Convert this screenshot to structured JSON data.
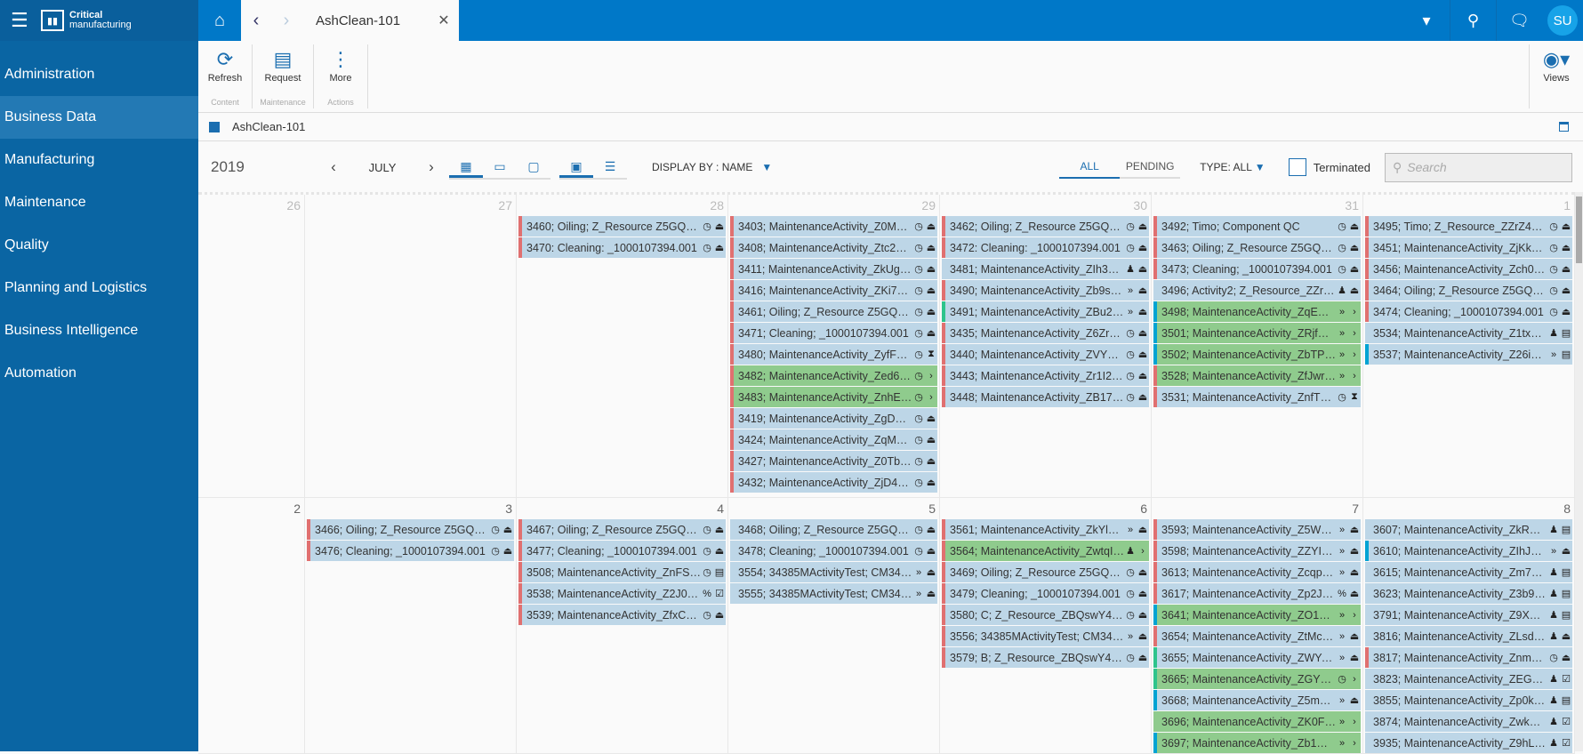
{
  "app": {
    "brand_top": "Critical",
    "brand_bottom": "manufacturing",
    "user_initials": "SU"
  },
  "tab": {
    "title": "AshClean-101"
  },
  "sidebar": {
    "items": [
      {
        "label": "Administration"
      },
      {
        "label": "Business Data",
        "active": true
      },
      {
        "label": "Manufacturing"
      },
      {
        "label": "Maintenance"
      },
      {
        "label": "Quality"
      },
      {
        "label": "Planning and Logistics"
      },
      {
        "label": "Business Intelligence"
      },
      {
        "label": "Automation"
      }
    ]
  },
  "toolbar": {
    "refresh": "Refresh",
    "request": "Request",
    "more": "More",
    "views": "Views",
    "group_content": "Content",
    "group_maintenance": "Maintenance",
    "group_actions": "Actions"
  },
  "breadcrumb": {
    "title": "AshClean-101"
  },
  "controls": {
    "year": "2019",
    "month": "JULY",
    "display_by": "DISPLAY BY : NAME",
    "filter_all": "ALL",
    "filter_pending": "PENDING",
    "type": "TYPE: ALL",
    "terminated": "Terminated",
    "search_placeholder": "Search"
  },
  "colors": {
    "accent": "#0078c8",
    "red": "#e07070",
    "teal": "#2ec48c",
    "cyan": "#00a3d3",
    "event_bg": "#bdd6e7",
    "event_green": "#8fcb8d"
  },
  "weeks": [
    {
      "days": [
        {
          "day": "26",
          "events": []
        },
        {
          "day": "27",
          "events": []
        },
        {
          "day": "28",
          "events": [
            {
              "text": "3460; Oiling; Z_Resource Z5GQkkWOn...",
              "bar": "red",
              "icons": [
                "clock",
                "eject"
              ]
            },
            {
              "text": "3470: Cleaning: _1000107394.001",
              "bar": "red",
              "icons": [
                "clock",
                "eject"
              ]
            }
          ]
        },
        {
          "day": "29",
          "events": [
            {
              "text": "3403; MaintenanceActivity_Z0M9FXqlt...",
              "bar": "red",
              "icons": [
                "clock",
                "eject"
              ]
            },
            {
              "text": "3408; MaintenanceActivity_Ztc2uKFak...",
              "bar": "red",
              "icons": [
                "clock",
                "eject"
              ]
            },
            {
              "text": "3411; MaintenanceActivity_ZkUgwpaYi...",
              "bar": "red",
              "icons": [
                "clock",
                "eject"
              ]
            },
            {
              "text": "3416; MaintenanceActivity_ZKi7cmgVP...",
              "bar": "red",
              "icons": [
                "clock",
                "eject"
              ]
            },
            {
              "text": "3461; Oiling; Z_Resource Z5GQkkWOn...",
              "bar": "red",
              "icons": [
                "clock",
                "eject"
              ]
            },
            {
              "text": "3471; Cleaning; _1000107394.001",
              "bar": "red",
              "icons": [
                "clock",
                "eject"
              ]
            },
            {
              "text": "3480; MaintenanceActivity_ZyfF3Xcba...",
              "bar": "red",
              "icons": [
                "clock",
                "hourglass"
              ]
            },
            {
              "text": "3482; MaintenanceActivity_Zed6lmUCl...",
              "bar": "red",
              "green": true,
              "icons": [
                "clock",
                "chevron"
              ]
            },
            {
              "text": "3483; MaintenanceActivity_ZnhEJ7mb...",
              "bar": "red",
              "green": true,
              "icons": [
                "clock",
                "chevron"
              ]
            },
            {
              "text": "3419; MaintenanceActivity_ZgDQ1cRB...",
              "bar": "red",
              "icons": [
                "clock",
                "eject"
              ]
            },
            {
              "text": "3424; MaintenanceActivity_ZqMYjzA66...",
              "bar": "red",
              "icons": [
                "clock",
                "eject"
              ]
            },
            {
              "text": "3427; MaintenanceActivity_Z0TbYPqEy...",
              "bar": "red",
              "icons": [
                "clock",
                "eject"
              ]
            },
            {
              "text": "3432; MaintenanceActivity_ZjD4A4Cxa...",
              "bar": "red",
              "icons": [
                "clock",
                "eject"
              ]
            }
          ]
        },
        {
          "day": "30",
          "events": [
            {
              "text": "3462; Oiling; Z_Resource Z5GQkkWOn...",
              "bar": "red",
              "icons": [
                "clock",
                "eject"
              ]
            },
            {
              "text": "3472: Cleaning: _1000107394.001",
              "bar": "red",
              "icons": [
                "clock",
                "eject"
              ]
            },
            {
              "text": "3481; MaintenanceActivity_ZIh3w9yCC...",
              "bar": "none",
              "icons": [
                "person",
                "eject"
              ]
            },
            {
              "text": "3490; MaintenanceActivity_Zb9sHaPX...",
              "bar": "red",
              "icons": [
                "triple",
                "eject"
              ]
            },
            {
              "text": "3491; MaintenanceActivity_ZBu26yocu...",
              "bar": "teal",
              "icons": [
                "triple",
                "eject"
              ]
            },
            {
              "text": "3435; MaintenanceActivity_Z6ZroGwU...",
              "bar": "red",
              "icons": [
                "clock",
                "eject"
              ]
            },
            {
              "text": "3440; MaintenanceActivity_ZVYYSP0vy...",
              "bar": "red",
              "icons": [
                "clock",
                "eject"
              ]
            },
            {
              "text": "3443; MaintenanceActivity_Zr1I2OIRd...",
              "bar": "red",
              "icons": [
                "clock",
                "eject"
              ]
            },
            {
              "text": "3448; MaintenanceActivity_ZB17EtSXK...",
              "bar": "red",
              "icons": [
                "clock",
                "eject"
              ]
            }
          ]
        },
        {
          "day": "31",
          "events": [
            {
              "text": "3492; Timo; Component QC",
              "bar": "red",
              "icons": [
                "clock",
                "eject"
              ]
            },
            {
              "text": "3463; Oiling; Z_Resource Z5GQkkWOn...",
              "bar": "red",
              "icons": [
                "clock",
                "eject"
              ]
            },
            {
              "text": "3473; Cleaning; _1000107394.001",
              "bar": "red",
              "icons": [
                "clock",
                "eject"
              ]
            },
            {
              "text": "3496; Activity2; Z_Resource_ZZrZ4ZwD...",
              "bar": "none",
              "icons": [
                "person",
                "eject"
              ]
            },
            {
              "text": "3498; MaintenanceActivity_ZqEUedplf...",
              "bar": "cyan",
              "green": true,
              "icons": [
                "triple",
                "chevron"
              ]
            },
            {
              "text": "3501; MaintenanceActivity_ZRjfMS0Tt...",
              "bar": "cyan",
              "green": true,
              "icons": [
                "triple",
                "chevron"
              ]
            },
            {
              "text": "3502; MaintenanceActivity_ZbTPfhyzcv...",
              "bar": "cyan",
              "green": true,
              "icons": [
                "triple",
                "chevron"
              ]
            },
            {
              "text": "3528; MaintenanceActivity_ZfJwrVqhq...",
              "bar": "red",
              "green": true,
              "icons": [
                "triple",
                "chevron"
              ]
            },
            {
              "text": "3531; MaintenanceActivity_ZnfTUK3M...",
              "bar": "red",
              "icons": [
                "clock",
                "hourglass"
              ]
            }
          ]
        },
        {
          "day": "1",
          "events": [
            {
              "text": "3495; Timo; Z_Resource_ZZrZ4ZwDNC...",
              "bar": "red",
              "icons": [
                "clock",
                "eject"
              ]
            },
            {
              "text": "3451; MaintenanceActivity_ZjKkEtZ5mj...",
              "bar": "red",
              "icons": [
                "clock",
                "eject"
              ]
            },
            {
              "text": "3456; MaintenanceActivity_Zch04k5m...",
              "bar": "red",
              "icons": [
                "clock",
                "eject"
              ]
            },
            {
              "text": "3464; Oiling; Z_Resource Z5GQkkWOn...",
              "bar": "red",
              "icons": [
                "clock",
                "eject"
              ]
            },
            {
              "text": "3474; Cleaning; _1000107394.001",
              "bar": "red",
              "icons": [
                "clock",
                "eject"
              ]
            },
            {
              "text": "3534; MaintenanceActivity_Z1tx5oSo2...",
              "bar": "none",
              "icons": [
                "person",
                "doc"
              ]
            },
            {
              "text": "3537; MaintenanceActivity_Z26iSDBwt...",
              "bar": "cyan",
              "icons": [
                "triple",
                "doc"
              ]
            }
          ]
        }
      ]
    },
    {
      "days": [
        {
          "day": "2",
          "events": []
        },
        {
          "day": "3",
          "events": [
            {
              "text": "3466; Oiling; Z_Resource Z5GQkkWOn...",
              "bar": "red",
              "icons": [
                "clock",
                "eject"
              ]
            },
            {
              "text": "3476; Cleaning; _1000107394.001",
              "bar": "red",
              "icons": [
                "clock",
                "eject"
              ]
            }
          ]
        },
        {
          "day": "4",
          "events": [
            {
              "text": "3467; Oiling; Z_Resource Z5GQkkWOn...",
              "bar": "red",
              "icons": [
                "clock",
                "eject"
              ]
            },
            {
              "text": "3477; Cleaning; _1000107394.001",
              "bar": "red",
              "icons": [
                "clock",
                "eject"
              ]
            },
            {
              "text": "3508; MaintenanceActivity_ZnFSVVVfjT...",
              "bar": "red",
              "icons": [
                "clock",
                "doc"
              ]
            },
            {
              "text": "3538; MaintenanceActivity_Z2J0Qj9SK...",
              "bar": "red",
              "icons": [
                "percent",
                "check"
              ]
            },
            {
              "text": "3539; MaintenanceActivity_ZfxCe0Adk...",
              "bar": "red",
              "icons": [
                "clock",
                "eject"
              ]
            }
          ]
        },
        {
          "day": "5",
          "events": [
            {
              "text": "3468; Oiling; Z_Resource Z5GQkkWOn...",
              "bar": "none",
              "icons": [
                "clock",
                "eject"
              ]
            },
            {
              "text": "3478; Cleaning; _1000107394.001",
              "bar": "none",
              "icons": [
                "clock",
                "eject"
              ]
            },
            {
              "text": "3554; 34385MActivityTest; CM34385_R...",
              "bar": "none",
              "icons": [
                "triple",
                "eject"
              ]
            },
            {
              "text": "3555; 34385MActivityTest; CM34385_R...",
              "bar": "none",
              "icons": [
                "triple",
                "eject"
              ]
            }
          ]
        },
        {
          "day": "6",
          "events": [
            {
              "text": "3561; MaintenanceActivity_ZkYl7mrXr...",
              "bar": "red",
              "icons": [
                "triple",
                "eject"
              ]
            },
            {
              "text": "3564; MaintenanceActivity_ZwtqIIcX2...",
              "bar": "red",
              "green": true,
              "icons": [
                "person",
                "chevron"
              ]
            },
            {
              "text": "3469; Oiling; Z_Resource Z5GQkkWOn...",
              "bar": "red",
              "icons": [
                "clock",
                "eject"
              ]
            },
            {
              "text": "3479; Cleaning; _1000107394.001",
              "bar": "red",
              "icons": [
                "clock",
                "eject"
              ]
            },
            {
              "text": "3580; C; Z_Resource_ZBQswY4m0riRbj...",
              "bar": "red",
              "icons": [
                "clock",
                "eject"
              ]
            },
            {
              "text": "3556; 34385MActivityTest; CM34385_R",
              "bar": "red",
              "icons": [
                "triple",
                "eject"
              ]
            },
            {
              "text": "3579; B; Z_Resource_ZBQswY4m0riRbj...",
              "bar": "red",
              "icons": [
                "clock",
                "eject"
              ]
            }
          ]
        },
        {
          "day": "7",
          "events": [
            {
              "text": "3593; MaintenanceActivity_Z5WCjpD3...",
              "bar": "red",
              "icons": [
                "triple",
                "eject"
              ]
            },
            {
              "text": "3598; MaintenanceActivity_ZZYIwPATP...",
              "bar": "red",
              "icons": [
                "triple",
                "eject"
              ]
            },
            {
              "text": "3613; MaintenanceActivity_ZcqpGLT6z...",
              "bar": "red",
              "icons": [
                "triple",
                "eject"
              ]
            },
            {
              "text": "3617; MaintenanceActivity_Zp2JYPVX2J...",
              "bar": "red",
              "icons": [
                "percent",
                "eject"
              ]
            },
            {
              "text": "3641; MaintenanceActivity_ZO1VsVWc...",
              "bar": "cyan",
              "green": true,
              "icons": [
                "triple",
                "chevron"
              ]
            },
            {
              "text": "3654; MaintenanceActivity_ZtMc89Or",
              "bar": "red",
              "icons": [
                "triple",
                "eject"
              ]
            },
            {
              "text": "3655; MaintenanceActivity_ZWYAhFo6...",
              "bar": "teal",
              "icons": [
                "triple",
                "eject"
              ]
            },
            {
              "text": "3665; MaintenanceActivity_ZGY9Ou3D...",
              "bar": "teal",
              "green": true,
              "icons": [
                "clock",
                "chevron"
              ]
            },
            {
              "text": "3668; MaintenanceActivity_Z5mxTBS6...",
              "bar": "cyan",
              "icons": [
                "triple",
                "eject"
              ]
            },
            {
              "text": "3696; MaintenanceActivity_ZK0FDiEb3...",
              "bar": "none",
              "green": true,
              "icons": [
                "triple",
                "chevron"
              ]
            },
            {
              "text": "3697; MaintenanceActivity_Zb1W7JOU...",
              "bar": "cyan",
              "green": true,
              "icons": [
                "triple",
                "chevron"
              ]
            }
          ]
        },
        {
          "day": "8",
          "events": [
            {
              "text": "3607; MaintenanceActivity_ZkRXst01x...",
              "bar": "none",
              "icons": [
                "person",
                "doc"
              ]
            },
            {
              "text": "3610; MaintenanceActivity_ZIhJRGII3x...",
              "bar": "cyan",
              "icons": [
                "triple",
                "eject"
              ]
            },
            {
              "text": "3615; MaintenanceActivity_Zm7UDTgn...",
              "bar": "none",
              "icons": [
                "person",
                "doc"
              ]
            },
            {
              "text": "3623; MaintenanceActivity_Z3b98b6ZR...",
              "bar": "none",
              "icons": [
                "person",
                "doc"
              ]
            },
            {
              "text": "3791; MaintenanceActivity_Z9XAUm25...",
              "bar": "none",
              "icons": [
                "person",
                "doc"
              ]
            },
            {
              "text": "3816; MaintenanceActivity_ZLsdQ1nl",
              "bar": "none",
              "icons": [
                "person",
                "eject"
              ]
            },
            {
              "text": "3817; MaintenanceActivity_ZnmMcDk...",
              "bar": "red",
              "icons": [
                "clock",
                "eject"
              ]
            },
            {
              "text": "3823; MaintenanceActivity_ZEG3a51v...",
              "bar": "none",
              "icons": [
                "person",
                "check"
              ]
            },
            {
              "text": "3855; MaintenanceActivity_Zp0kxRRJC...",
              "bar": "none",
              "icons": [
                "person",
                "doc"
              ]
            },
            {
              "text": "3874; MaintenanceActivity_ZwkC6HN...",
              "bar": "none",
              "icons": [
                "person",
                "check"
              ]
            },
            {
              "text": "3935; MaintenanceActivity_Z9hLkfdPy...",
              "bar": "none",
              "icons": [
                "person",
                "check"
              ]
            }
          ]
        }
      ]
    }
  ]
}
